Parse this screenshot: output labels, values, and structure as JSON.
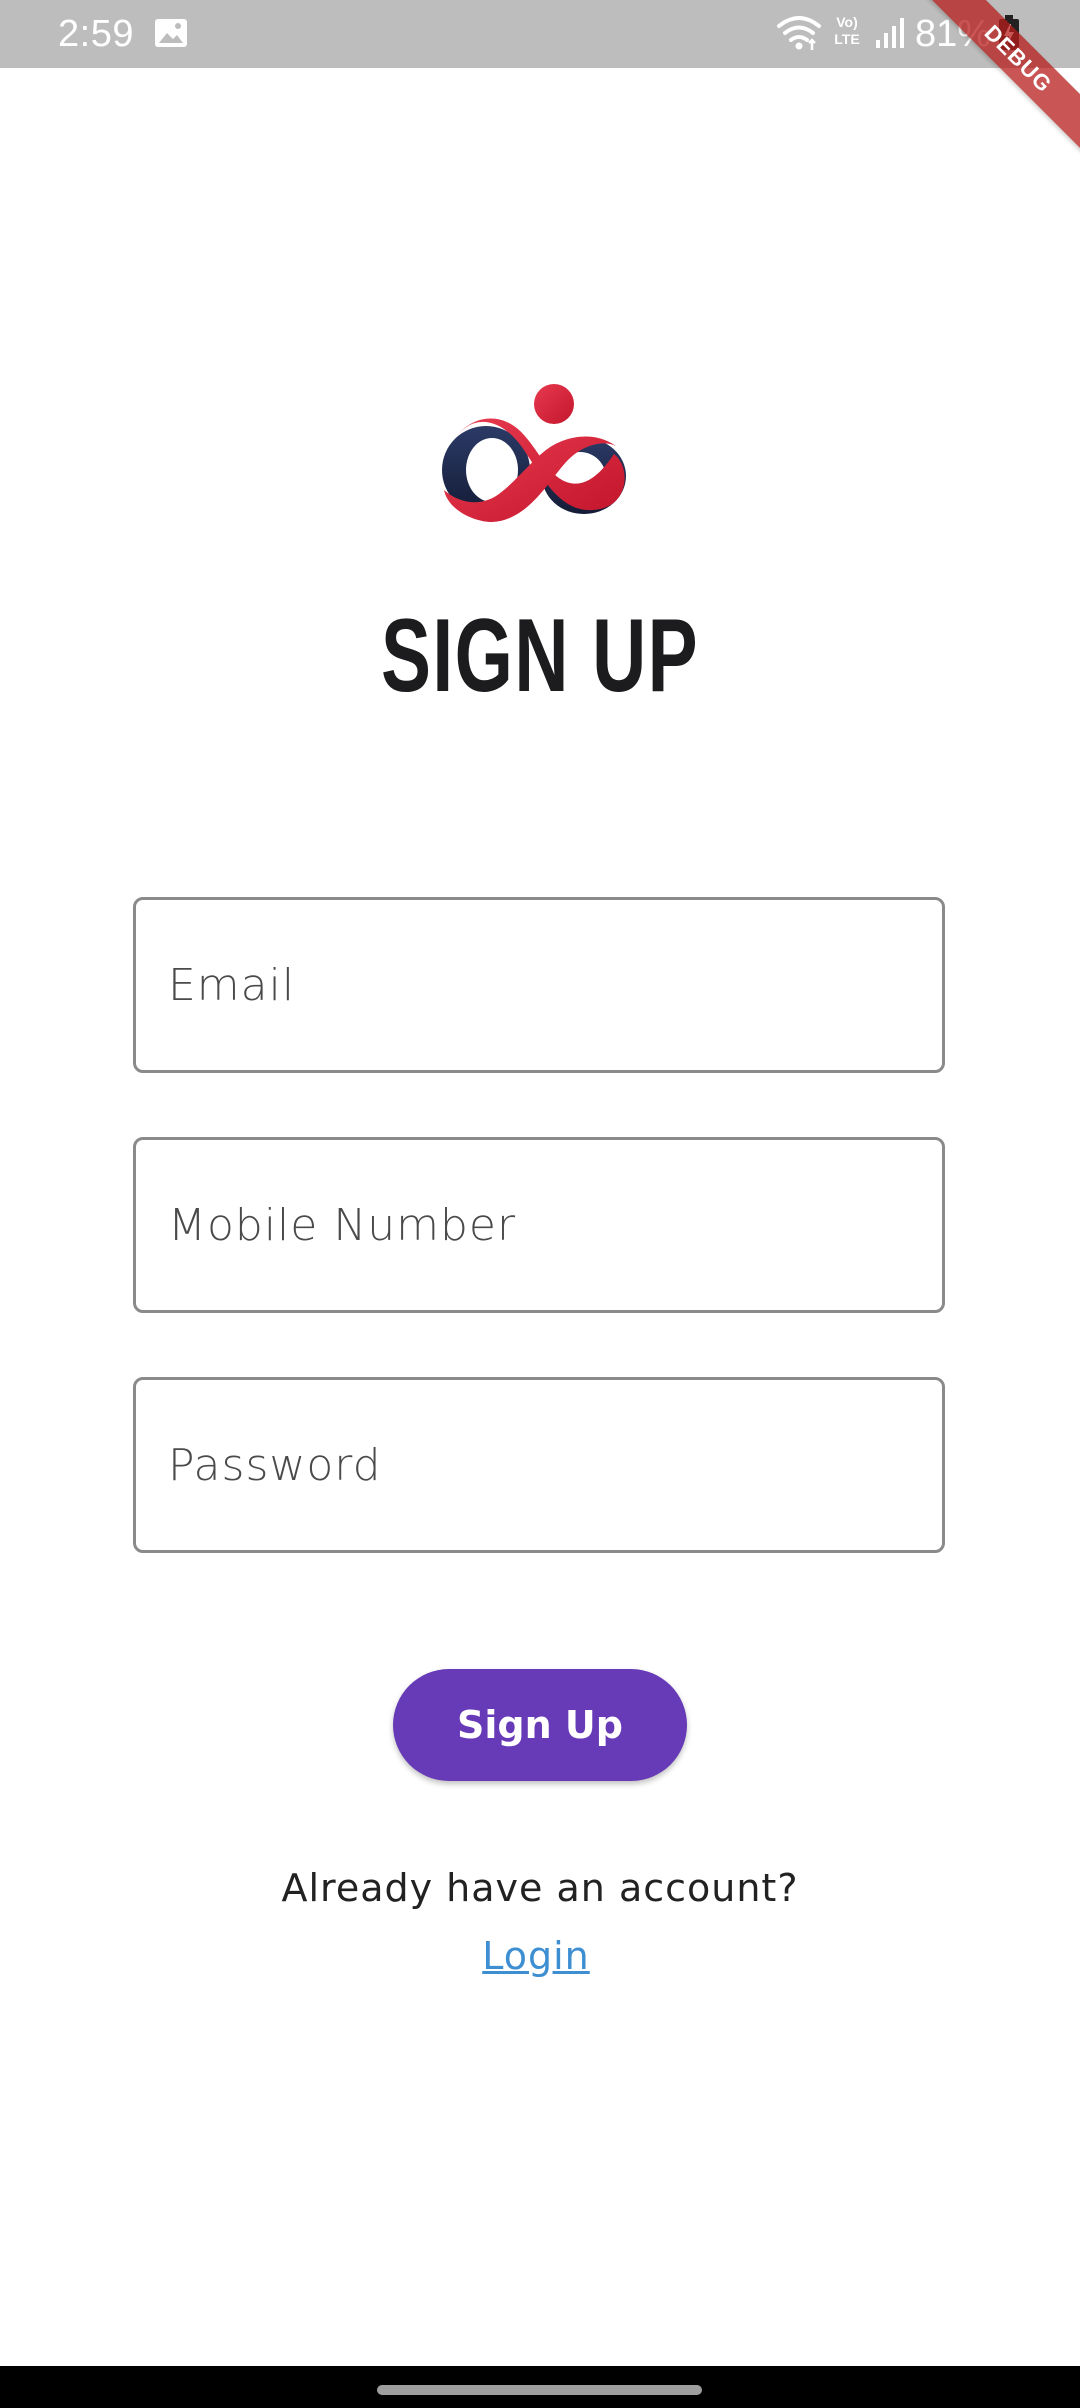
{
  "status_bar": {
    "time": "2:59",
    "volte_top": "Vo)",
    "volte_bottom": "LTE",
    "battery": "81%"
  },
  "debug_banner": "DEBUG",
  "title": "SIGN UP",
  "form": {
    "email_placeholder": "Email",
    "mobile_placeholder": "Mobile Number",
    "password_placeholder": "Password",
    "email_value": "",
    "mobile_value": "",
    "password_value": ""
  },
  "signup_button_label": "Sign Up",
  "footer": {
    "prompt": "Already have an account?",
    "login_link": "Login"
  },
  "colors": {
    "primary": "#673ab7",
    "link": "#3d8fd1",
    "logo_red": "#d7263d",
    "logo_navy": "#1e2a4a",
    "status_bar_bg": "#bdbdbd",
    "debug_banner": "#b71c1c"
  },
  "icons": {
    "status": [
      "gallery-icon",
      "wifi-icon",
      "volte-icon",
      "signal-icon",
      "battery-charging-icon"
    ],
    "logo": "infinity-person-logo"
  }
}
